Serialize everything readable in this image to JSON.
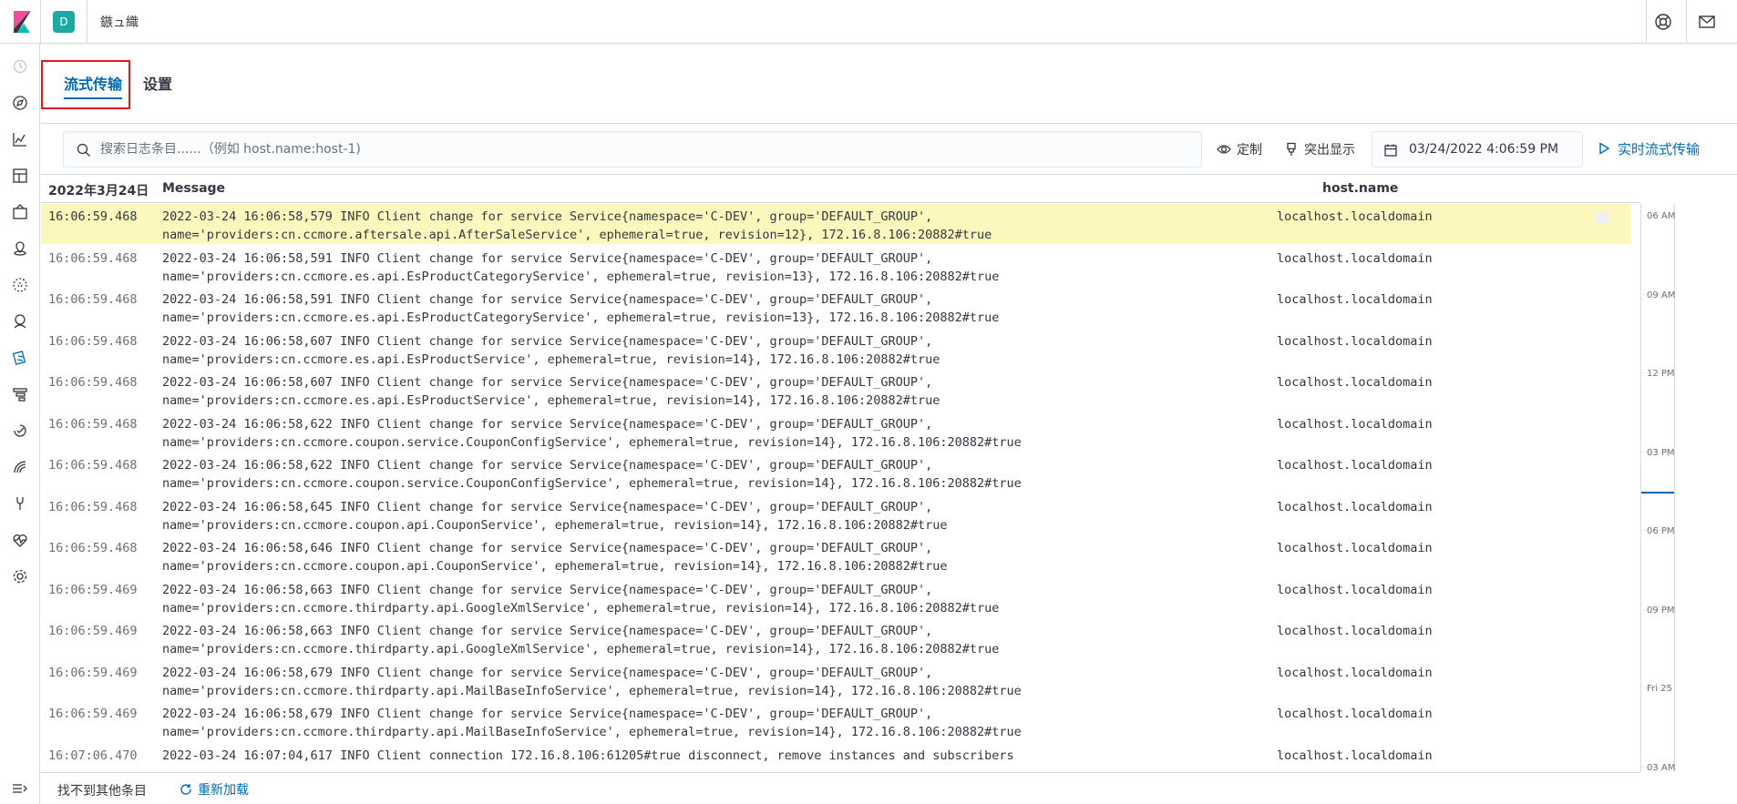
{
  "header": {
    "space_initial": "D",
    "breadcrumb": "鏃ュ織"
  },
  "tabs": {
    "stream_label": "流式传输",
    "settings_label": "设置"
  },
  "toolbar": {
    "search_placeholder": "搜索日志条目......（例如 host.name:host-1)",
    "customize_label": "定制",
    "highlight_label": "突出显示",
    "date_value": "03/24/2022 4:06:59 PM",
    "stream_live_label": "实时流式传输"
  },
  "table": {
    "col_date": "2022年3月24日",
    "col_message": "Message",
    "col_host": "host.name",
    "rows": [
      {
        "ts": "16:06:59.468",
        "msg": "2022-03-24 16:06:58,579 INFO Client change for service Service{namespace='C-DEV', group='DEFAULT_GROUP', name='providers:cn.ccmore.aftersale.api.AfterSaleService', ephemeral=true, revision=12}, 172.16.8.106:20882#true",
        "host": "localhost.localdomain",
        "highlighted": true
      },
      {
        "ts": "16:06:59.468",
        "msg": "2022-03-24 16:06:58,591 INFO Client change for service Service{namespace='C-DEV', group='DEFAULT_GROUP', name='providers:cn.ccmore.es.api.EsProductCategoryService', ephemeral=true, revision=13}, 172.16.8.106:20882#true",
        "host": "localhost.localdomain"
      },
      {
        "ts": "16:06:59.468",
        "msg": "2022-03-24 16:06:58,591 INFO Client change for service Service{namespace='C-DEV', group='DEFAULT_GROUP', name='providers:cn.ccmore.es.api.EsProductCategoryService', ephemeral=true, revision=13}, 172.16.8.106:20882#true",
        "host": "localhost.localdomain"
      },
      {
        "ts": "16:06:59.468",
        "msg": "2022-03-24 16:06:58,607 INFO Client change for service Service{namespace='C-DEV', group='DEFAULT_GROUP', name='providers:cn.ccmore.es.api.EsProductService', ephemeral=true, revision=14}, 172.16.8.106:20882#true",
        "host": "localhost.localdomain"
      },
      {
        "ts": "16:06:59.468",
        "msg": "2022-03-24 16:06:58,607 INFO Client change for service Service{namespace='C-DEV', group='DEFAULT_GROUP', name='providers:cn.ccmore.es.api.EsProductService', ephemeral=true, revision=14}, 172.16.8.106:20882#true",
        "host": "localhost.localdomain"
      },
      {
        "ts": "16:06:59.468",
        "msg": "2022-03-24 16:06:58,622 INFO Client change for service Service{namespace='C-DEV', group='DEFAULT_GROUP', name='providers:cn.ccmore.coupon.service.CouponConfigService', ephemeral=true, revision=14}, 172.16.8.106:20882#true",
        "host": "localhost.localdomain"
      },
      {
        "ts": "16:06:59.468",
        "msg": "2022-03-24 16:06:58,622 INFO Client change for service Service{namespace='C-DEV', group='DEFAULT_GROUP', name='providers:cn.ccmore.coupon.service.CouponConfigService', ephemeral=true, revision=14}, 172.16.8.106:20882#true",
        "host": "localhost.localdomain"
      },
      {
        "ts": "16:06:59.468",
        "msg": "2022-03-24 16:06:58,645 INFO Client change for service Service{namespace='C-DEV', group='DEFAULT_GROUP', name='providers:cn.ccmore.coupon.api.CouponService', ephemeral=true, revision=14}, 172.16.8.106:20882#true",
        "host": "localhost.localdomain"
      },
      {
        "ts": "16:06:59.468",
        "msg": "2022-03-24 16:06:58,646 INFO Client change for service Service{namespace='C-DEV', group='DEFAULT_GROUP', name='providers:cn.ccmore.coupon.api.CouponService', ephemeral=true, revision=14}, 172.16.8.106:20882#true",
        "host": "localhost.localdomain"
      },
      {
        "ts": "16:06:59.469",
        "msg": "2022-03-24 16:06:58,663 INFO Client change for service Service{namespace='C-DEV', group='DEFAULT_GROUP', name='providers:cn.ccmore.thirdparty.api.GoogleXmlService', ephemeral=true, revision=14}, 172.16.8.106:20882#true",
        "host": "localhost.localdomain"
      },
      {
        "ts": "16:06:59.469",
        "msg": "2022-03-24 16:06:58,663 INFO Client change for service Service{namespace='C-DEV', group='DEFAULT_GROUP', name='providers:cn.ccmore.thirdparty.api.GoogleXmlService', ephemeral=true, revision=14}, 172.16.8.106:20882#true",
        "host": "localhost.localdomain"
      },
      {
        "ts": "16:06:59.469",
        "msg": "2022-03-24 16:06:58,679 INFO Client change for service Service{namespace='C-DEV', group='DEFAULT_GROUP', name='providers:cn.ccmore.thirdparty.api.MailBaseInfoService', ephemeral=true, revision=14}, 172.16.8.106:20882#true",
        "host": "localhost.localdomain"
      },
      {
        "ts": "16:06:59.469",
        "msg": "2022-03-24 16:06:58,679 INFO Client change for service Service{namespace='C-DEV', group='DEFAULT_GROUP', name='providers:cn.ccmore.thirdparty.api.MailBaseInfoService', ephemeral=true, revision=14}, 172.16.8.106:20882#true",
        "host": "localhost.localdomain"
      },
      {
        "ts": "16:07:06.470",
        "msg": "2022-03-24 16:07:04,617 INFO Client connection 172.16.8.106:61205#true disconnect, remove instances and subscribers",
        "host": "localhost.localdomain"
      }
    ]
  },
  "minimap": {
    "labels": [
      "06 AM",
      "09 AM",
      "12 PM",
      "03 PM",
      "06 PM",
      "09 PM",
      "Fri 25",
      "03 AM"
    ]
  },
  "footer": {
    "no_more_label": "找不到其他条目",
    "reload_label": "重新加载"
  },
  "colors": {
    "accent": "#006bb4",
    "highlight_row": "#fcf7bc",
    "annotation_box": "#e0191c",
    "space_avatar": "#1ba9a1"
  }
}
